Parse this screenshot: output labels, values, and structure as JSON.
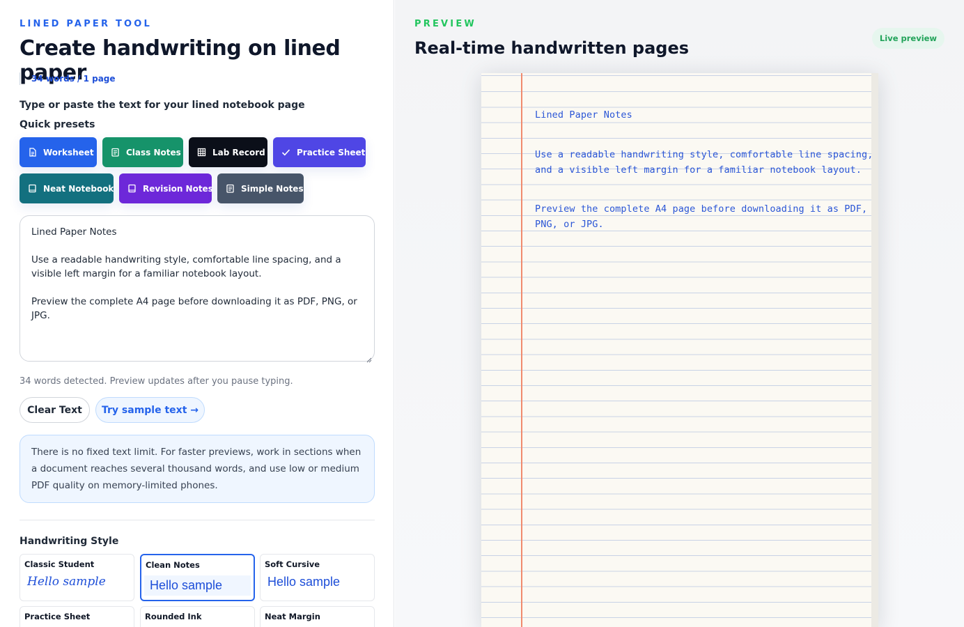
{
  "left": {
    "eyebrow": "LINED PAPER TOOL",
    "title": "Create handwriting on lined paper",
    "count": "34 words / 1 page",
    "prompt": "Type or paste the text for your lined notebook page",
    "presets_label": "Quick presets",
    "presets": [
      {
        "label": "Worksheet",
        "icon": "document-icon",
        "color": "#2563eb"
      },
      {
        "label": "Class Notes",
        "icon": "notes-icon",
        "color": "#16936a"
      },
      {
        "label": "Lab Record",
        "icon": "grid-icon",
        "color": "#0b0f19"
      },
      {
        "label": "Practice Sheet",
        "icon": "check-icon",
        "color": "#4f46e5"
      },
      {
        "label": "Neat Notebook",
        "icon": "notebook-icon",
        "color": "#13707f"
      },
      {
        "label": "Revision Notes",
        "icon": "notebook-icon",
        "color": "#6d28d9"
      },
      {
        "label": "Simple Notes",
        "icon": "notes-icon",
        "color": "#475569"
      }
    ],
    "text_lines": [
      "Lined Paper Notes",
      "Use a readable handwriting style, comfortable line spacing, and a visible left margin for a familiar notebook layout.",
      "Preview the complete A4 page before downloading it as PDF, PNG, or JPG."
    ],
    "detected": "34 words detected. Preview updates after you pause typing.",
    "clear_label": "Clear Text",
    "sample_label": "Try sample text →",
    "info": "There is no fixed text limit. For faster previews, work in sections when a document reaches several thousand words, and use low or medium PDF quality on memory-limited phones.",
    "style_label": "Handwriting Style",
    "styles": [
      {
        "name": "Classic Student",
        "sample": "Hello sample"
      },
      {
        "name": "Clean Notes",
        "sample": "Hello sample"
      },
      {
        "name": "Soft Cursive",
        "sample": "Hello sample"
      },
      {
        "name": "Practice Sheet",
        "sample": ""
      },
      {
        "name": "Rounded Ink",
        "sample": ""
      },
      {
        "name": "Neat Margin",
        "sample": ""
      }
    ]
  },
  "right": {
    "eyebrow": "PREVIEW",
    "title": "Real-time handwritten pages",
    "badge": "Live preview",
    "paper_lines": [
      "Lined Paper Notes",
      "Use a readable handwriting style, comfortable line spacing,",
      "and a visible left margin for a familiar notebook layout.",
      "Preview the complete A4 page before downloading it as PDF,",
      "PNG, or JPG."
    ]
  },
  "colors": {
    "accent": "#2563eb",
    "preview_accent": "#22c55e",
    "ink": "#2b56d6",
    "margin_line": "#f08a6e"
  }
}
